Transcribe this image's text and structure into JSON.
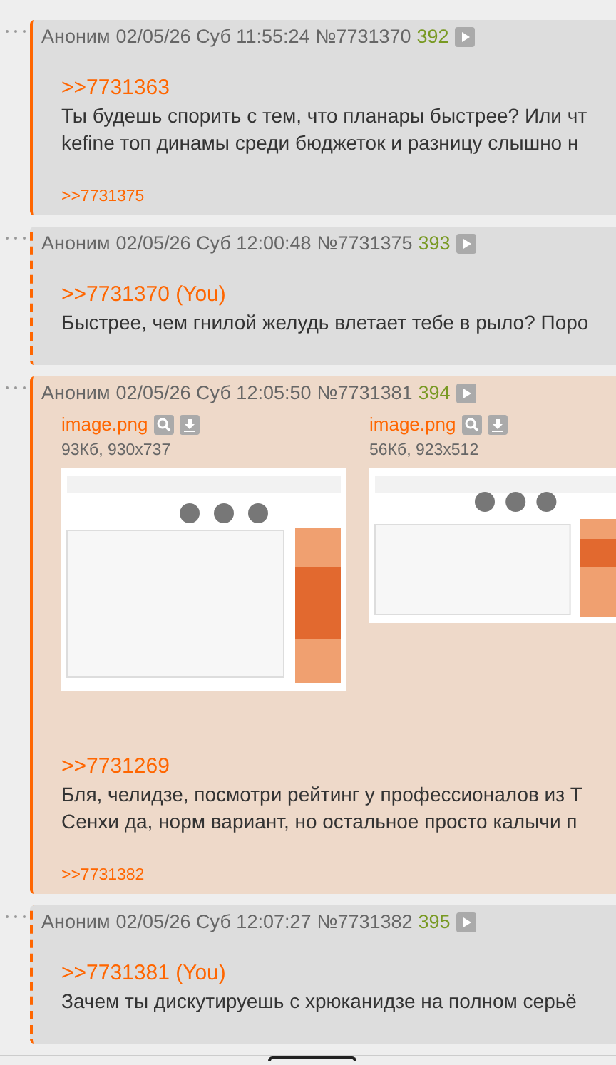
{
  "posts": [
    {
      "author": "Аноним",
      "date": "02/05/26 Суб 11:55:24",
      "number": "№7731370",
      "ordinal": "392",
      "highlighted": false,
      "reply_to_you": false,
      "quote": ">>7731363",
      "lines": [
        "Ты будешь спорить с тем, что планары быстрее? Или чт",
        "kefine топ динамы среди бюджеток и разницу слышно н"
      ],
      "replies": [
        ">>7731375"
      ]
    },
    {
      "author": "Аноним",
      "date": "02/05/26 Суб 12:00:48",
      "number": "№7731375",
      "ordinal": "393",
      "highlighted": false,
      "reply_to_you": true,
      "quote": ">>7731370 (You)",
      "lines": [
        "Быстрее, чем гнилой желудь влетает тебе в рыло? Поро"
      ]
    },
    {
      "author": "Аноним",
      "date": "02/05/26 Суб 12:05:50",
      "number": "№7731381",
      "ordinal": "394",
      "highlighted": true,
      "reply_to_you": false,
      "files": [
        {
          "name": "image.png",
          "meta": "93Кб, 930x737",
          "kind": "picture"
        },
        {
          "name": "image.png",
          "meta": "56Кб, 923x512",
          "kind": "picture"
        }
      ],
      "quote": ">>7731269",
      "lines": [
        "Бля, челидзе, посмотри рейтинг у профессионалов из Т",
        "Сенхи да, норм вариант, но остальное просто калычи п"
      ],
      "replies": [
        ">>7731382"
      ]
    },
    {
      "author": "Аноним",
      "date": "02/05/26 Суб 12:07:27",
      "number": "№7731382",
      "ordinal": "395",
      "highlighted": false,
      "reply_to_you": true,
      "quote": ">>7731381 (You)",
      "lines": [
        "Зачем ты дискутируешь с хрюканидзе на полном серьё"
      ]
    }
  ]
}
